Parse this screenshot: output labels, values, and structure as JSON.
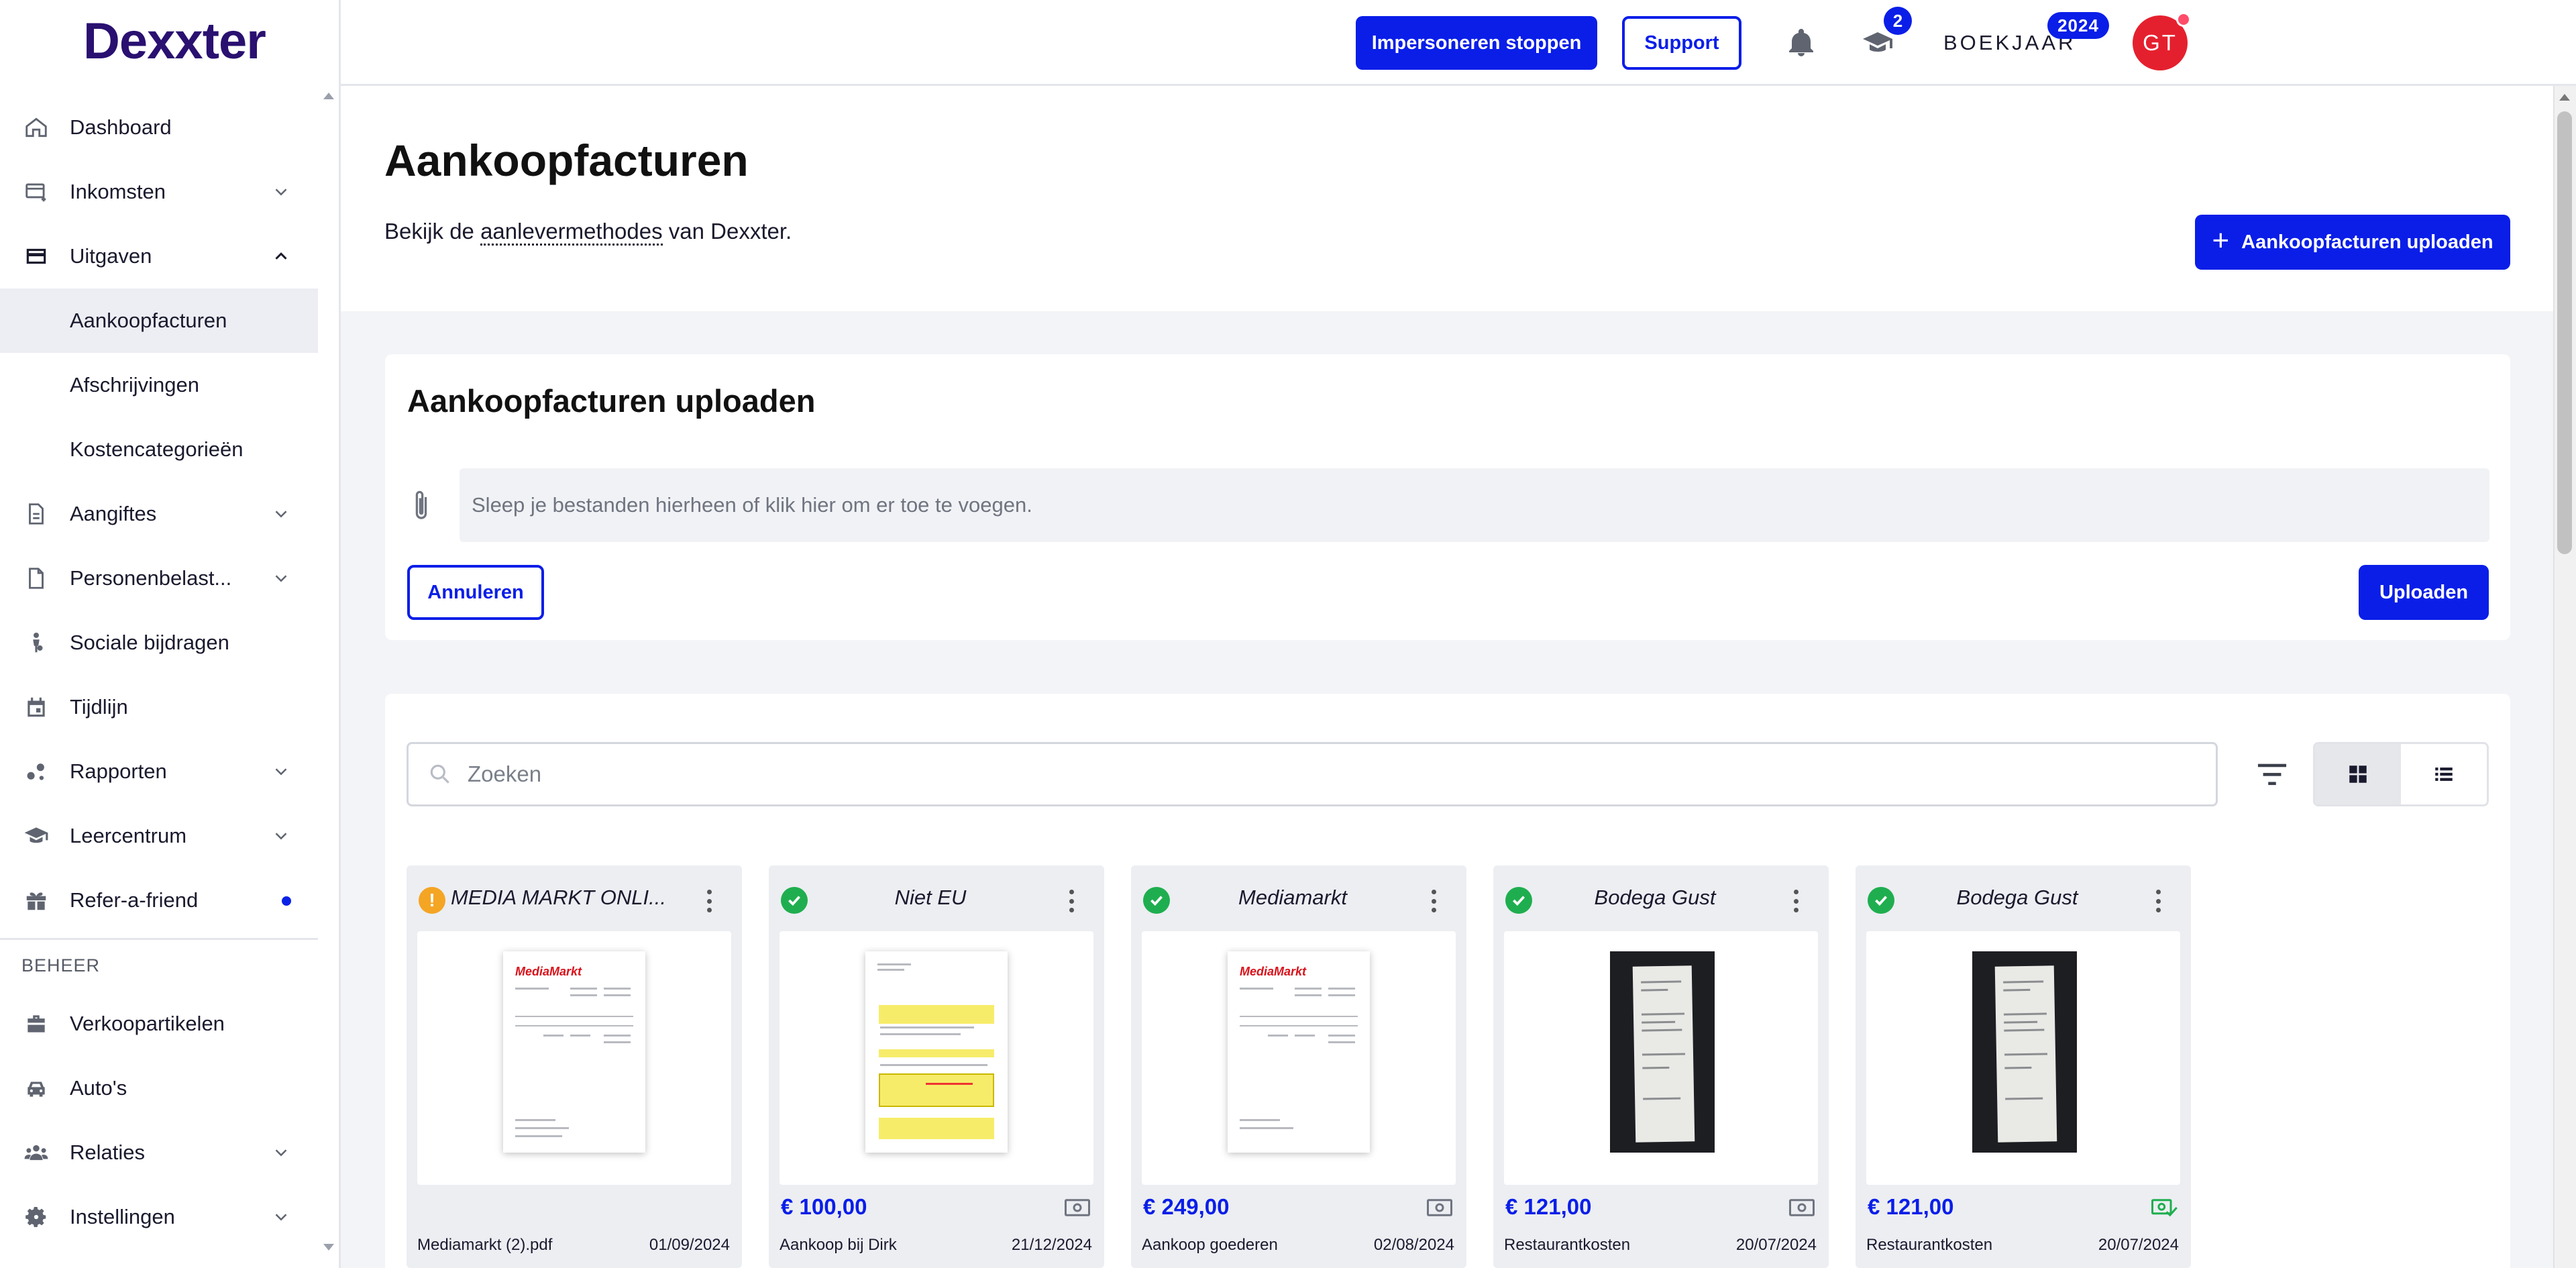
{
  "app": {
    "logo": "Dexxter"
  },
  "topbar": {
    "impersonate_label": "Impersoneren stoppen",
    "support_label": "Support",
    "learning_badge": "2",
    "boekjaar_label": "BOEKJAAR",
    "year_badge": "2024",
    "avatar_initials": "GT"
  },
  "sidebar": {
    "items": [
      {
        "label": "Dashboard",
        "icon": "home-icon",
        "chevron": ""
      },
      {
        "label": "Inkomsten",
        "icon": "income-icon",
        "chevron": "down"
      },
      {
        "label": "Uitgaven",
        "icon": "card-icon",
        "chevron": "up"
      },
      {
        "label": "Aankoopfacturen",
        "sub": true,
        "active": true
      },
      {
        "label": "Afschrijvingen",
        "sub": true
      },
      {
        "label": "Kostencategorieën",
        "sub": true
      },
      {
        "label": "Aangiftes",
        "icon": "document-icon",
        "chevron": "down"
      },
      {
        "label": "Personenbelast...",
        "icon": "file-icon",
        "chevron": "down"
      },
      {
        "label": "Sociale bijdragen",
        "icon": "person-icon",
        "chevron": ""
      },
      {
        "label": "Tijdlijn",
        "icon": "calendar-icon",
        "chevron": ""
      },
      {
        "label": "Rapporten",
        "icon": "chart-icon",
        "chevron": "down"
      },
      {
        "label": "Leercentrum",
        "icon": "graduation-cap-icon",
        "chevron": "down"
      },
      {
        "label": "Refer-a-friend",
        "icon": "gift-icon",
        "dot": true
      }
    ],
    "section_label": "BEHEER",
    "beheer_items": [
      {
        "label": "Verkoopartikelen",
        "icon": "briefcase-icon",
        "chevron": ""
      },
      {
        "label": "Auto's",
        "icon": "car-icon",
        "chevron": ""
      },
      {
        "label": "Relaties",
        "icon": "people-icon",
        "chevron": "down"
      },
      {
        "label": "Instellingen",
        "icon": "gear-icon",
        "chevron": "down"
      }
    ]
  },
  "page": {
    "title": "Aankoopfacturen",
    "subtitle_pre": "Bekijk de ",
    "subtitle_link": "aanlevermethodes",
    "subtitle_post": " van Dexxter.",
    "upload_button": "Aankoopfacturen uploaden"
  },
  "upload": {
    "title": "Aankoopfacturen uploaden",
    "dropzone_text": "Sleep je bestanden hierheen of klik hier om er toe te voegen.",
    "cancel_label": "Annuleren",
    "upload_label": "Uploaden"
  },
  "invoices": {
    "search_placeholder": "Zoeken",
    "items": [
      {
        "supplier": "MEDIA MARKT ONLI...",
        "status": "warning",
        "amount": "",
        "description": "Mediamarkt (2).pdf",
        "date": "01/09/2024",
        "thumb": "mediamarkt-invoice"
      },
      {
        "supplier": "Niet EU",
        "status": "ok",
        "amount": "€ 100,00",
        "description": "Aankoop bij Dirk",
        "date": "21/12/2024",
        "thumb": "yellow-invoice"
      },
      {
        "supplier": "Mediamarkt",
        "status": "ok",
        "amount": "€ 249,00",
        "description": "Aankoop goederen",
        "date": "02/08/2024",
        "thumb": "mediamarkt-invoice"
      },
      {
        "supplier": "Bodega Gust",
        "status": "ok",
        "amount": "€ 121,00",
        "description": "Restaurantkosten",
        "date": "20/07/2024",
        "thumb": "receipt-photo"
      },
      {
        "supplier": "Bodega Gust",
        "status": "ok",
        "amount": "€ 121,00",
        "description": "Restaurantkosten",
        "date": "20/07/2024",
        "thumb": "receipt-photo",
        "paid": true
      }
    ]
  },
  "colors": {
    "accent": "#0a1ee8",
    "logo": "#2a1070",
    "ok": "#1fae4f",
    "warning": "#f4a524",
    "avatar": "#e5202e"
  }
}
